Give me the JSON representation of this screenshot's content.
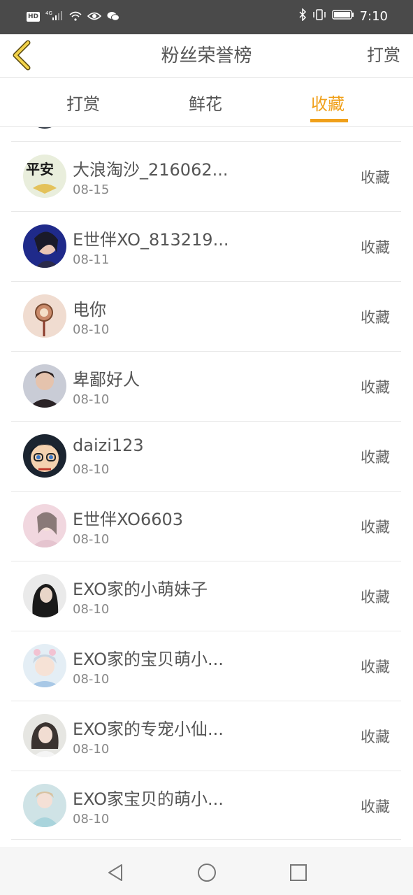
{
  "status_bar": {
    "hd": "HD",
    "network": "4G",
    "time": "7:10"
  },
  "header": {
    "title": "粉丝荣誉榜",
    "right_action": "打赏",
    "back_icon": "chevron-left-icon",
    "accent_color": "#f0a01a"
  },
  "tabs": [
    {
      "label": "打赏",
      "active": false
    },
    {
      "label": "鲜花",
      "active": false
    },
    {
      "label": "收藏",
      "active": true
    }
  ],
  "list": [
    {
      "name": "大浪淘沙_216062...",
      "date": "08-15",
      "action": "收藏"
    },
    {
      "name": "E世伴XO_813219...",
      "date": "08-11",
      "action": "收藏"
    },
    {
      "name": "电你",
      "date": "08-10",
      "action": "收藏"
    },
    {
      "name": "卑鄙好人",
      "date": "08-10",
      "action": "收藏"
    },
    {
      "name": "daizi123",
      "date": "08-10",
      "action": "收藏"
    },
    {
      "name": "E世伴XO6603",
      "date": "08-10",
      "action": "收藏"
    },
    {
      "name": "EXO家的小萌妹子",
      "date": "08-10",
      "action": "收藏"
    },
    {
      "name": "EXO家的宝贝萌小...",
      "date": "08-10",
      "action": "收藏"
    },
    {
      "name": "EXO家的专宠小仙...",
      "date": "08-10",
      "action": "收藏"
    },
    {
      "name": "EXO家宝贝的萌小...",
      "date": "08-10",
      "action": "收藏"
    }
  ],
  "navbar": {
    "back": "triangle-back-icon",
    "home": "circle-home-icon",
    "recents": "square-recents-icon"
  }
}
